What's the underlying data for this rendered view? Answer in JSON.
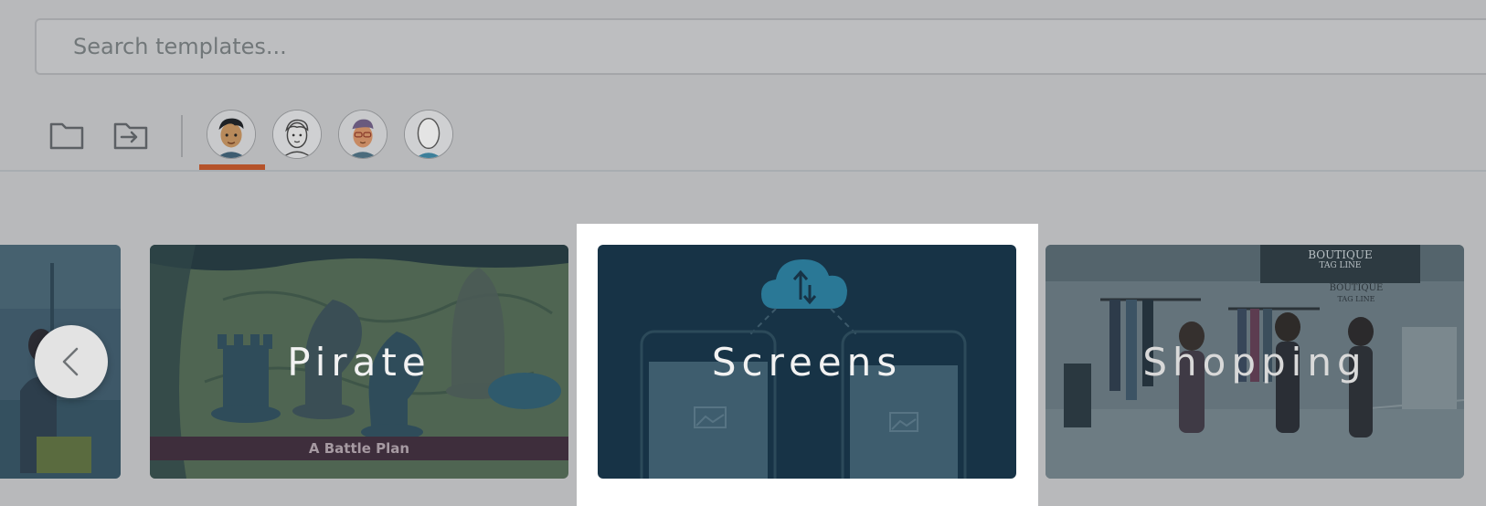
{
  "search": {
    "placeholder": "Search templates...",
    "value": ""
  },
  "toolbar": {
    "folder_icon": "folder-icon",
    "import_icon": "folder-import-icon",
    "avatars": [
      {
        "style": "cartoon-dark-hair",
        "selected": true
      },
      {
        "style": "line-art-male",
        "selected": false
      },
      {
        "style": "cartoon-glasses",
        "selected": false
      },
      {
        "style": "line-art-outline",
        "selected": false
      }
    ],
    "accent_color": "#b5532a"
  },
  "carousel": {
    "prev_icon": "chevron-left-icon",
    "templates": [
      {
        "label": "",
        "theme": "office"
      },
      {
        "label": "Pirate",
        "sublabel": "A Battle Plan",
        "theme": "chess-map"
      },
      {
        "label": "Screens",
        "theme": "devices-cloud",
        "selected": true
      },
      {
        "label": "Shopping",
        "theme": "boutique",
        "store_sign": "BOUTIQUE",
        "store_tagline": "TAG LINE"
      }
    ]
  }
}
